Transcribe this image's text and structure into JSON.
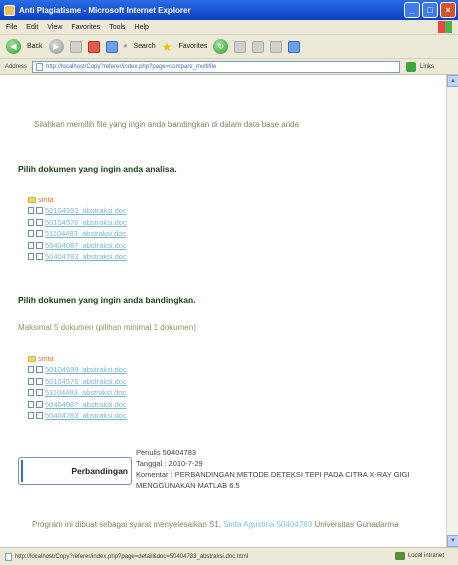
{
  "window": {
    "title": "Anti Plagiatisme - Microsoft Internet Explorer"
  },
  "menu": [
    "File",
    "Edit",
    "View",
    "Favorites",
    "Tools",
    "Help"
  ],
  "toolbar": {
    "back_label": "Back",
    "search_label": "Search",
    "favorites_label": "Favorites"
  },
  "address": {
    "label": "Address",
    "url": "http://localhost/Copy?referer/index.php?page=compare_multifile",
    "links_label": "Links"
  },
  "page": {
    "intro": "Silahkan memilih file yang ingin anda bandingkan di dalam data base anda",
    "section_analyze": {
      "heading": "Pilih dokumen yang ingin anda analisa.",
      "folder": "sinta",
      "files": [
        "50104593_abstraksi.doc",
        "50104576_abstraksi.doc",
        "51104483_abstraksi.doc",
        "50404087_abstraksi.doc",
        "50404783_abstraksi.doc"
      ]
    },
    "section_compare": {
      "heading": "Pilih dokumen yang ingin anda bandingkan.",
      "note": "Maksimal 5 dokumen (pilihan minimal 1 dokumen)",
      "folder": "sinta",
      "files": [
        "50104599_abstraksi.doc",
        "50104576_abstraksi.doc",
        "51104483_abstraksi.doc",
        "50404087_abstraksi.doc",
        "50404783_abstraksi.doc"
      ]
    },
    "compare_button": "Perbandingan",
    "info": {
      "penulis": "Penulis 50404783",
      "tanggal": "Tanggal : 2010-7-29",
      "komentar_1": "Komentar : PERBANDINGAN METODE DETEKSI TEPI PADA CITRA X-RAY GIGI",
      "komentar_2": "MENGGUNAKAN MATLAB 6.5"
    },
    "footer": {
      "prefix": "Program ini dibuat sebagai syarat menyelesaikan S1,",
      "highlight": "Sinta Agustina 50404783",
      "suffix": "Universitas Gunadarma"
    }
  },
  "status": {
    "url": "http://localhost/Copy?referer/index.php?page=detail&doc=50404783_abstraksi.doc.html",
    "zone": "Local intranet"
  },
  "colors": {
    "title_bar": "#0a3fc2",
    "chrome": "#ece9d8",
    "link": "#7ab7cf",
    "folder": "#d9763a"
  }
}
